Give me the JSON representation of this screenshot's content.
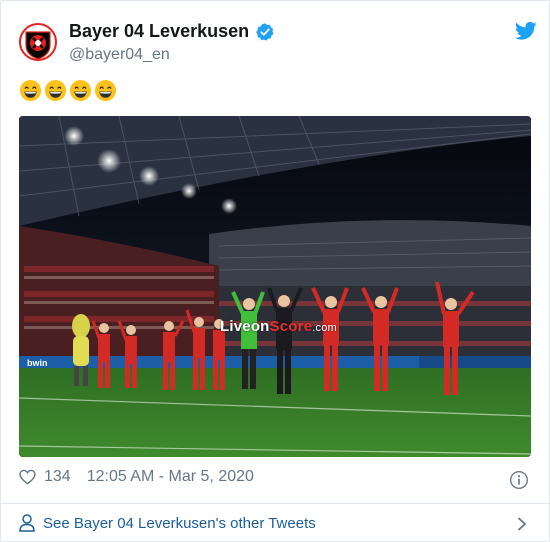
{
  "tweet": {
    "display_name": "Bayer 04 Leverkusen",
    "handle": "@bayer04_en",
    "text": "😄😄😄😄",
    "likes": "134",
    "timestamp": "12:05 AM - Mar 5, 2020",
    "footer_link": "See Bayer 04 Leverkusen's other Tweets"
  },
  "media": {
    "watermark_main": "Liveon",
    "watermark_accent": "Score",
    "watermark_suffix": ".com",
    "ad_board_text": "bwin"
  },
  "icons": {
    "avatar": "bayer-04-crest-icon",
    "verified": "verified-badge-icon",
    "brand": "twitter-bird-icon",
    "like": "heart-icon",
    "info": "info-icon",
    "profile": "person-icon",
    "next": "chevron-right-icon"
  },
  "colors": {
    "twitter_blue": "#1da1f2",
    "text_primary": "#14171a",
    "text_secondary": "#657786",
    "link": "#1b5e9c",
    "bayer_red": "#e32219"
  }
}
